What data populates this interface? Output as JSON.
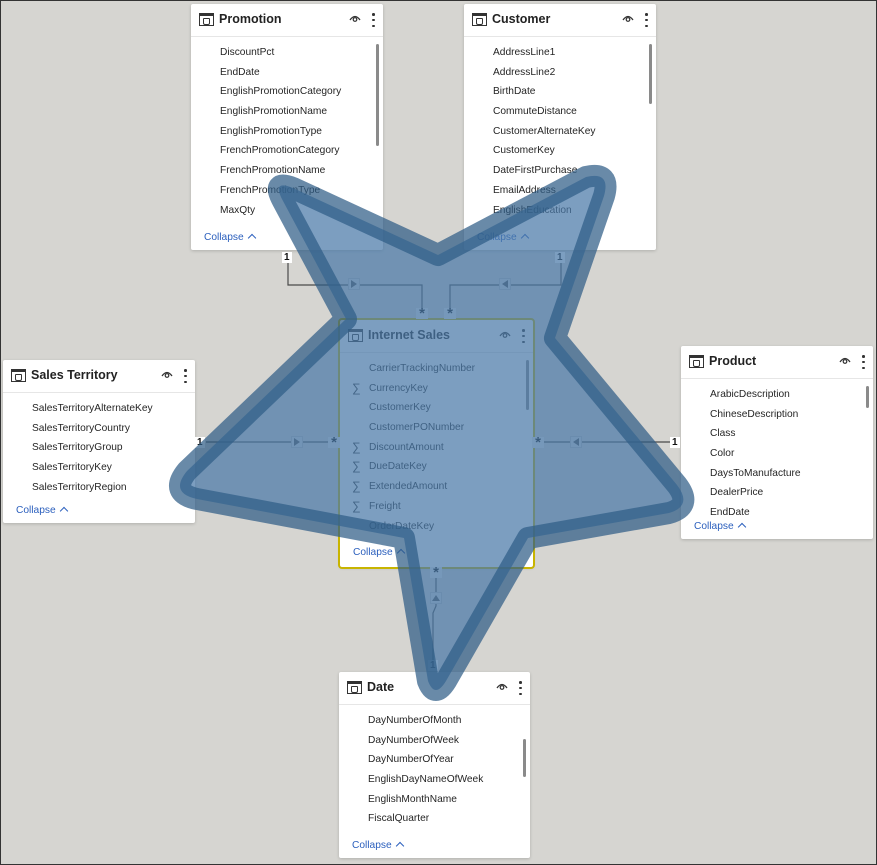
{
  "colors": {
    "canvas": "#d6d5d1",
    "card": "#ffffff",
    "selected_outline": "#c8b400",
    "link": "#2b5fbd",
    "star_fill": "#4a79a8",
    "star_stroke": "#2f5d86"
  },
  "common": {
    "collapse_label": "Collapse",
    "one_label": "1",
    "many_label": "*"
  },
  "tables": {
    "promotion": {
      "title": "Promotion",
      "fields": [
        {
          "name": "DiscountPct",
          "sum": false
        },
        {
          "name": "EndDate",
          "sum": false
        },
        {
          "name": "EnglishPromotionCategory",
          "sum": false
        },
        {
          "name": "EnglishPromotionName",
          "sum": false
        },
        {
          "name": "EnglishPromotionType",
          "sum": false
        },
        {
          "name": "FrenchPromotionCategory",
          "sum": false
        },
        {
          "name": "FrenchPromotionName",
          "sum": false
        },
        {
          "name": "FrenchPromotionType",
          "sum": false
        },
        {
          "name": "MaxQty",
          "sum": false
        }
      ]
    },
    "customer": {
      "title": "Customer",
      "fields": [
        {
          "name": "AddressLine1",
          "sum": false
        },
        {
          "name": "AddressLine2",
          "sum": false
        },
        {
          "name": "BirthDate",
          "sum": false
        },
        {
          "name": "CommuteDistance",
          "sum": false
        },
        {
          "name": "CustomerAlternateKey",
          "sum": false
        },
        {
          "name": "CustomerKey",
          "sum": false
        },
        {
          "name": "DateFirstPurchase",
          "sum": false
        },
        {
          "name": "EmailAddress",
          "sum": false
        },
        {
          "name": "EnglishEducation",
          "sum": false
        }
      ]
    },
    "internet_sales": {
      "title": "Internet Sales",
      "fields": [
        {
          "name": "CarrierTrackingNumber",
          "sum": false
        },
        {
          "name": "CurrencyKey",
          "sum": true
        },
        {
          "name": "CustomerKey",
          "sum": false
        },
        {
          "name": "CustomerPONumber",
          "sum": false
        },
        {
          "name": "DiscountAmount",
          "sum": true
        },
        {
          "name": "DueDateKey",
          "sum": true
        },
        {
          "name": "ExtendedAmount",
          "sum": true
        },
        {
          "name": "Freight",
          "sum": true
        },
        {
          "name": "OrderDateKey",
          "sum": false
        }
      ]
    },
    "sales_territory": {
      "title": "Sales Territory",
      "fields": [
        {
          "name": "SalesTerritoryAlternateKey",
          "sum": false
        },
        {
          "name": "SalesTerritoryCountry",
          "sum": false
        },
        {
          "name": "SalesTerritoryGroup",
          "sum": false
        },
        {
          "name": "SalesTerritoryKey",
          "sum": false
        },
        {
          "name": "SalesTerritoryRegion",
          "sum": false
        }
      ]
    },
    "product": {
      "title": "Product",
      "fields": [
        {
          "name": "ArabicDescription",
          "sum": false
        },
        {
          "name": "ChineseDescription",
          "sum": false
        },
        {
          "name": "Class",
          "sum": false
        },
        {
          "name": "Color",
          "sum": false
        },
        {
          "name": "DaysToManufacture",
          "sum": false
        },
        {
          "name": "DealerPrice",
          "sum": false
        },
        {
          "name": "EndDate",
          "sum": false
        }
      ]
    },
    "date": {
      "title": "Date",
      "fields": [
        {
          "name": "DayNumberOfMonth",
          "sum": false
        },
        {
          "name": "DayNumberOfWeek",
          "sum": false
        },
        {
          "name": "DayNumberOfYear",
          "sum": false
        },
        {
          "name": "EnglishDayNameOfWeek",
          "sum": false
        },
        {
          "name": "EnglishMonthName",
          "sum": false
        },
        {
          "name": "FiscalQuarter",
          "sum": false
        }
      ]
    }
  },
  "relationships": [
    {
      "from": "Promotion",
      "to": "Internet Sales",
      "from_card": "1",
      "to_card": "*",
      "direction": "right"
    },
    {
      "from": "Customer",
      "to": "Internet Sales",
      "from_card": "1",
      "to_card": "*",
      "direction": "left"
    },
    {
      "from": "Sales Territory",
      "to": "Internet Sales",
      "from_card": "1",
      "to_card": "*",
      "direction": "right"
    },
    {
      "from": "Product",
      "to": "Internet Sales",
      "from_card": "1",
      "to_card": "*",
      "direction": "left"
    },
    {
      "from": "Date",
      "to": "Internet Sales",
      "from_card": "1",
      "to_card": "*",
      "direction": "up"
    }
  ]
}
